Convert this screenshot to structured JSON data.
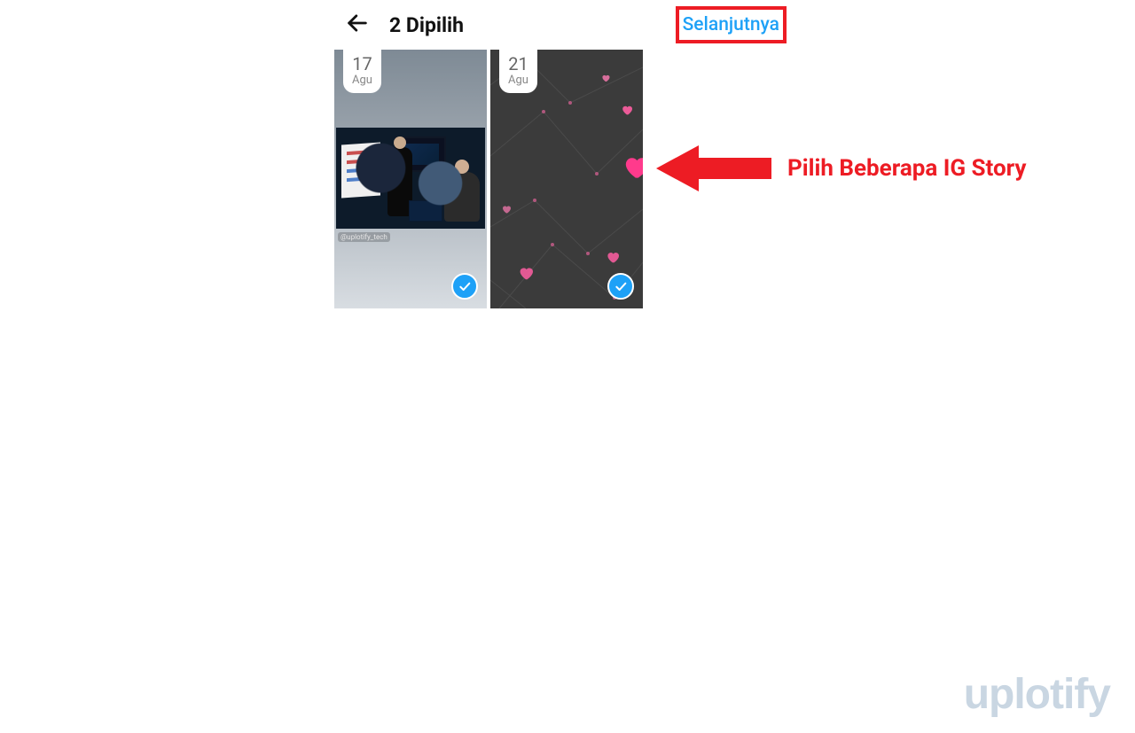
{
  "header": {
    "title": "2 Dipilih",
    "next_label": "Selanjutnya"
  },
  "stories": [
    {
      "day": "17",
      "month": "Agu",
      "handle": "@uplotify_tech",
      "selected": true
    },
    {
      "day": "21",
      "month": "Agu",
      "selected": true
    }
  ],
  "callout": {
    "text": "Pilih Beberapa IG Story"
  },
  "colors": {
    "accent_red": "#ed1c24",
    "accent_blue": "#1ea1f7"
  },
  "watermark": "uplotify"
}
